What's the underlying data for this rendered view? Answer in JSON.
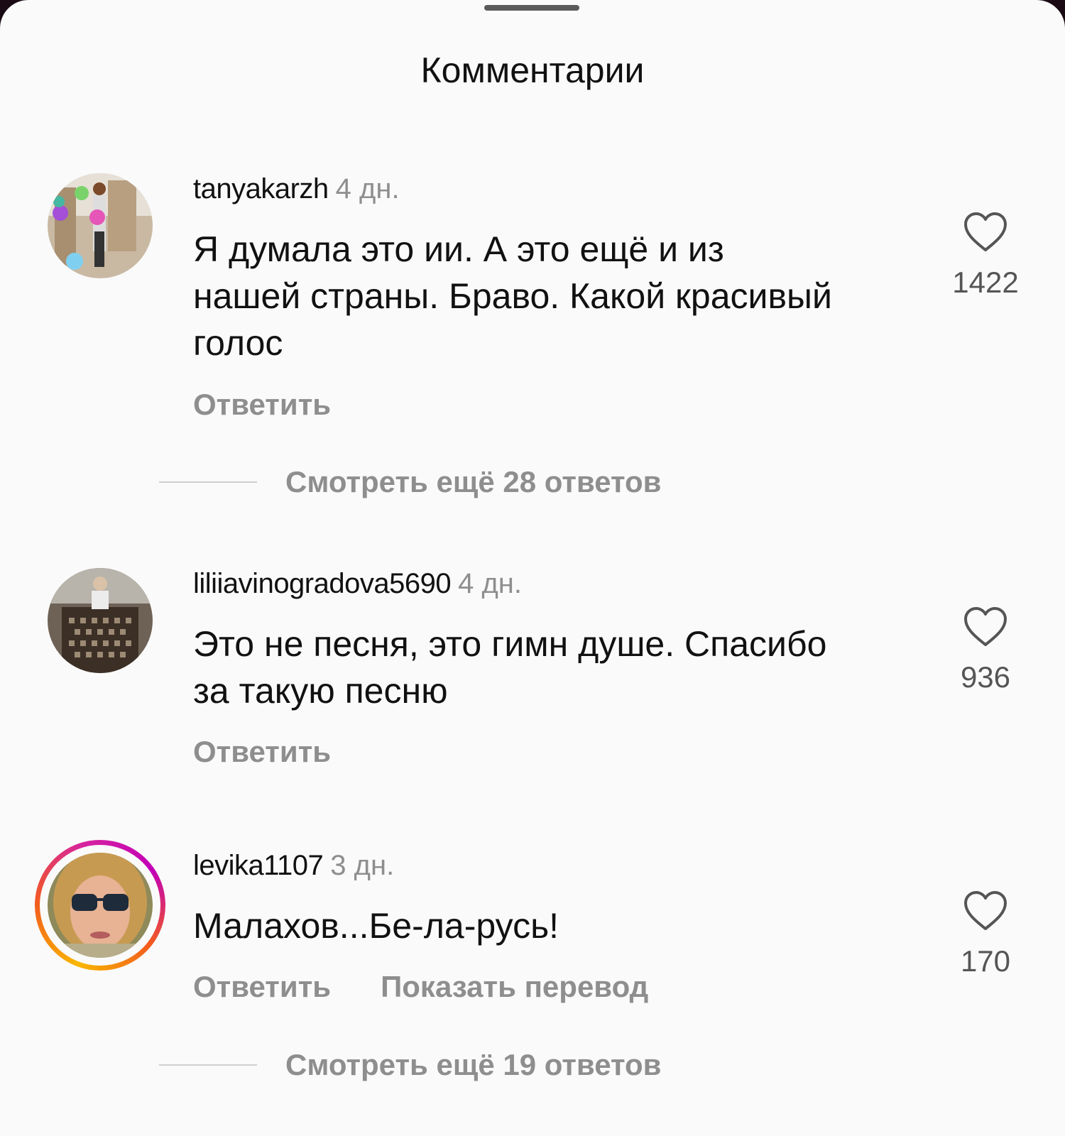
{
  "sheet": {
    "title": "Комментарии"
  },
  "comments": [
    {
      "username": "tanyakarzh",
      "time": "4 дн.",
      "text": "Я думала это ии. А это ещё и из нашей страны. Браво. Какой красивый голос",
      "reply_label": "Ответить",
      "likes": "1422",
      "more_replies": "Смотреть ещё 28 ответов"
    },
    {
      "username": "liliiavinogradova5690",
      "time": "4 дн.",
      "text": "Это не песня, это гимн душе. Спасибо за такую песню",
      "reply_label": "Ответить",
      "likes": "936"
    },
    {
      "username": "levika1107",
      "time": "3 дн.",
      "text": "Малахов...Бе-ла-русь!",
      "reply_label": "Ответить",
      "translate_label": "Показать перевод",
      "likes": "170",
      "more_replies": "Смотреть ещё 19 ответов"
    }
  ],
  "icons": {
    "like": "heart-outline-icon"
  },
  "colors": {
    "muted": "#8e8e8e",
    "text": "#111111",
    "story_ring": "#d6249f"
  }
}
